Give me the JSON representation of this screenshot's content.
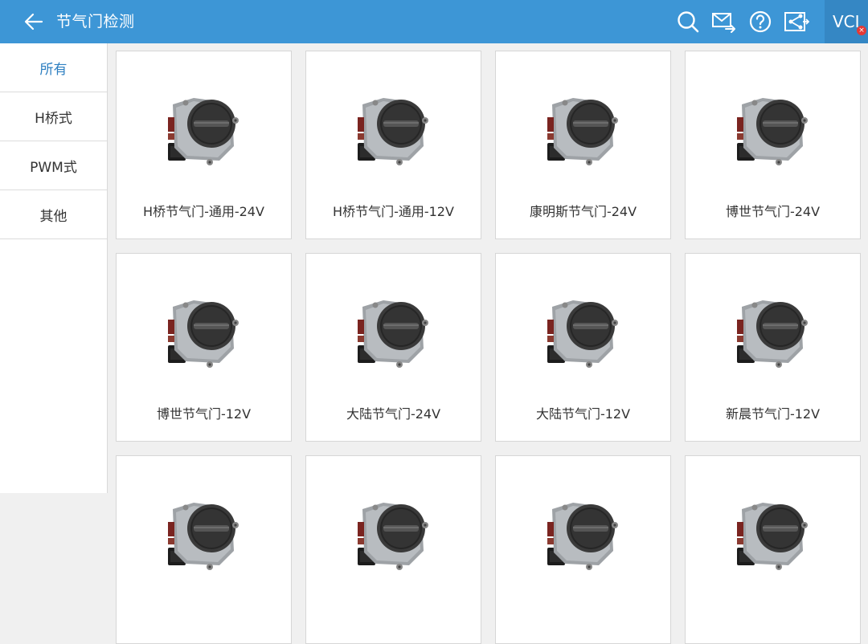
{
  "header": {
    "title": "节气门检测",
    "icons": [
      "back-arrow-icon",
      "search-icon",
      "mail-send-icon",
      "help-icon",
      "share-icon"
    ],
    "vci_label": "VCI",
    "vci_badge": "×",
    "bg_color": "#3d96d6"
  },
  "sidebar": {
    "items": [
      {
        "label": "所有",
        "active": true
      },
      {
        "label": "H桥式",
        "active": false
      },
      {
        "label": "PWM式",
        "active": false
      },
      {
        "label": "其他",
        "active": false
      }
    ],
    "active_color": "#2d7fc1"
  },
  "grid": {
    "items": [
      {
        "label": "H桥节气门-通用-24V"
      },
      {
        "label": "H桥节气门-通用-12V"
      },
      {
        "label": "康明斯节气门-24V"
      },
      {
        "label": "博世节气门-24V"
      },
      {
        "label": "博世节气门-12V"
      },
      {
        "label": "大陆节气门-24V"
      },
      {
        "label": "大陆节气门-12V"
      },
      {
        "label": "新晨节气门-12V"
      },
      {
        "label": ""
      },
      {
        "label": ""
      },
      {
        "label": ""
      },
      {
        "label": ""
      }
    ],
    "item_icon": "throttle-body-icon"
  }
}
